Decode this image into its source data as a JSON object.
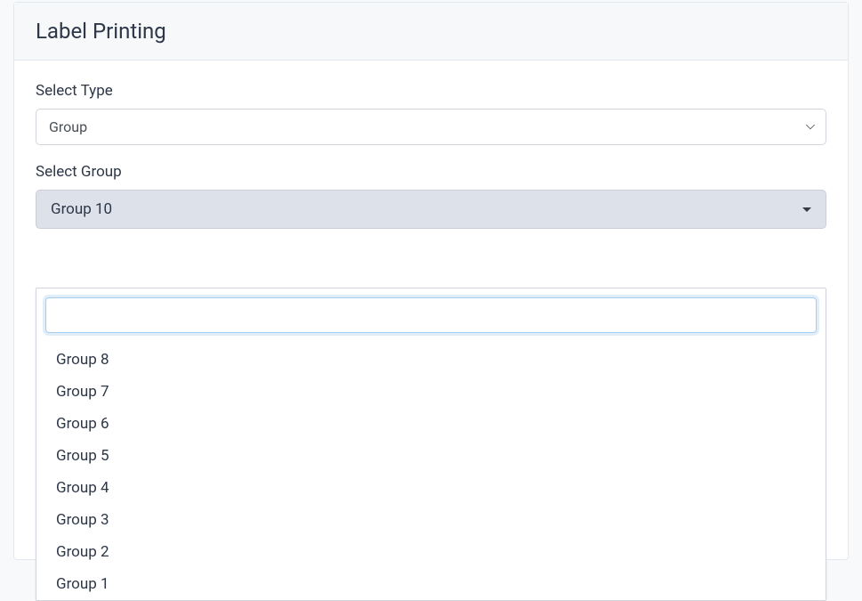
{
  "header": {
    "title": "Label Printing"
  },
  "form": {
    "type_label": "Select Type",
    "type_value": "Group",
    "group_label": "Select Group",
    "group_selected": "Group 10",
    "search_value": "",
    "options": [
      "Group 8",
      "Group 7",
      "Group 6",
      "Group 5",
      "Group 4",
      "Group 3",
      "Group 2",
      "Group 1"
    ]
  }
}
